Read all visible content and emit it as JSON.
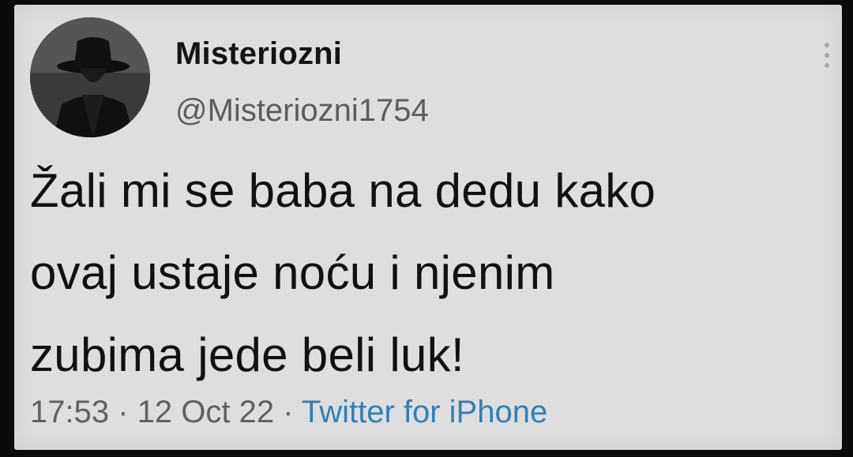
{
  "tweet": {
    "display_name": "Misteriozni",
    "handle": "@Misteriozni1754",
    "text_lines": [
      "Žali mi se baba na dedu kako",
      "ovaj ustaje noću i njenim",
      "zubima jede beli luk!"
    ],
    "time": "17:53",
    "separator": "·",
    "date": "12 Oct 22",
    "source": "Twitter for iPhone",
    "source_color": "#2f80b8"
  },
  "avatar": {
    "icon": "silhouette-hat-avatar"
  },
  "menu": {
    "icon": "more-options-icon"
  }
}
